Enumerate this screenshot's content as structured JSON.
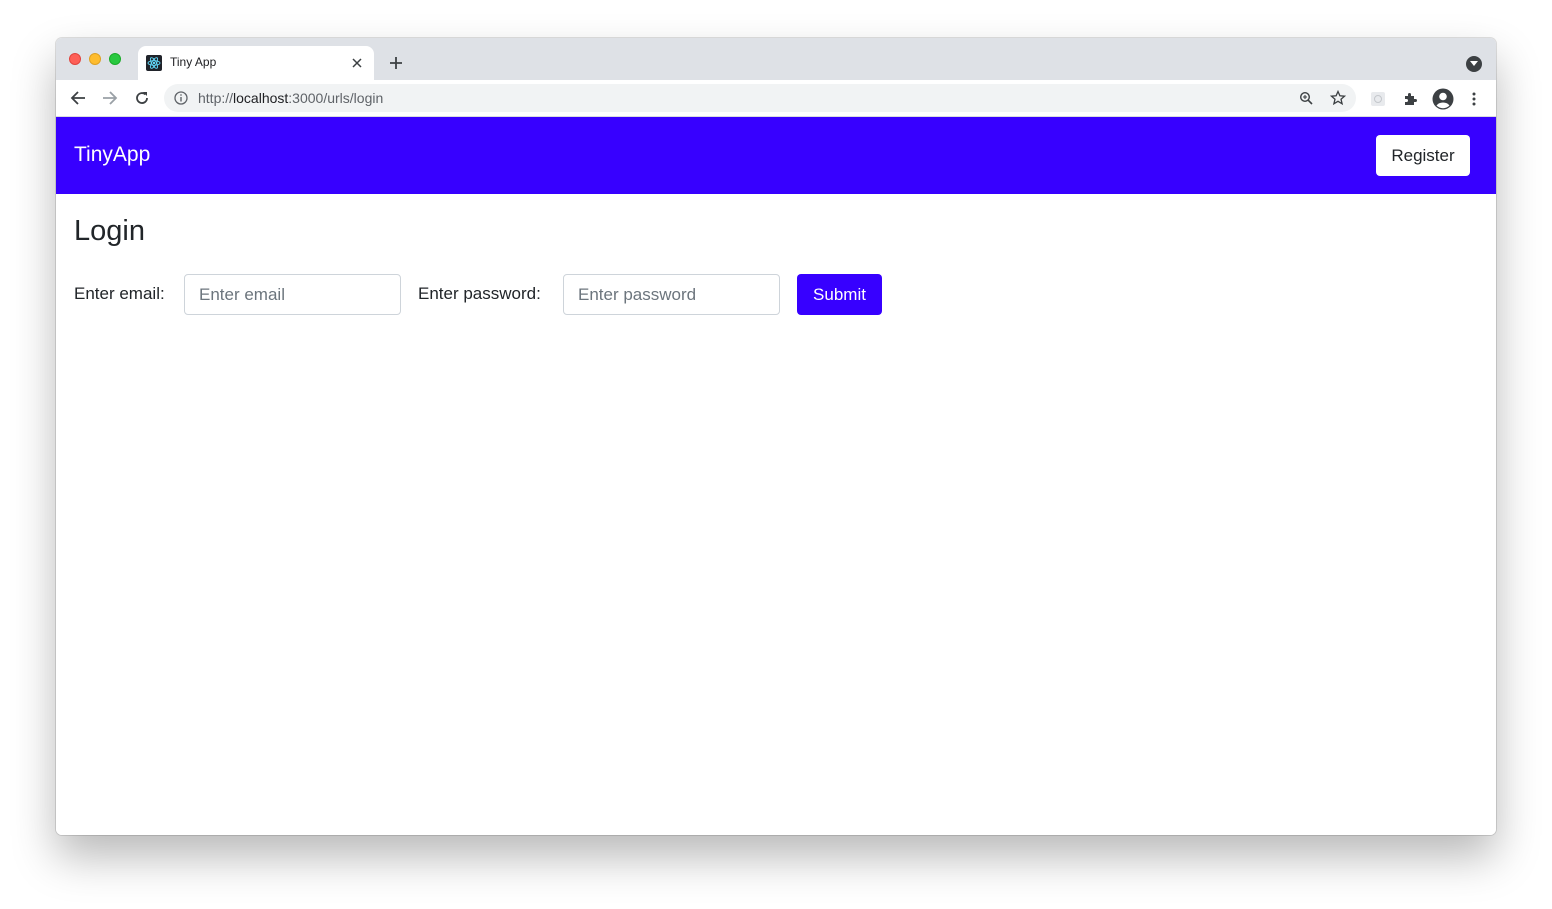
{
  "browser": {
    "tab_title": "Tiny App",
    "url_scheme": "http://",
    "url_host": "localhost",
    "url_path": ":3000/urls/login",
    "icons": [
      "back-icon",
      "forward-icon",
      "reload-icon",
      "info-icon",
      "zoom-icon",
      "star-icon",
      "extension-icon",
      "puzzle-icon",
      "profile-icon",
      "menu-icon",
      "tab-search-icon",
      "close-icon",
      "plus-icon"
    ]
  },
  "navbar": {
    "brand": "TinyApp",
    "register_label": "Register",
    "color": "#3700ff"
  },
  "main": {
    "heading": "Login",
    "email_label": "Enter email:",
    "email_placeholder": "Enter email",
    "email_value": "",
    "password_label": "Enter password:",
    "password_placeholder": "Enter password",
    "password_value": "",
    "submit_label": "Submit"
  }
}
